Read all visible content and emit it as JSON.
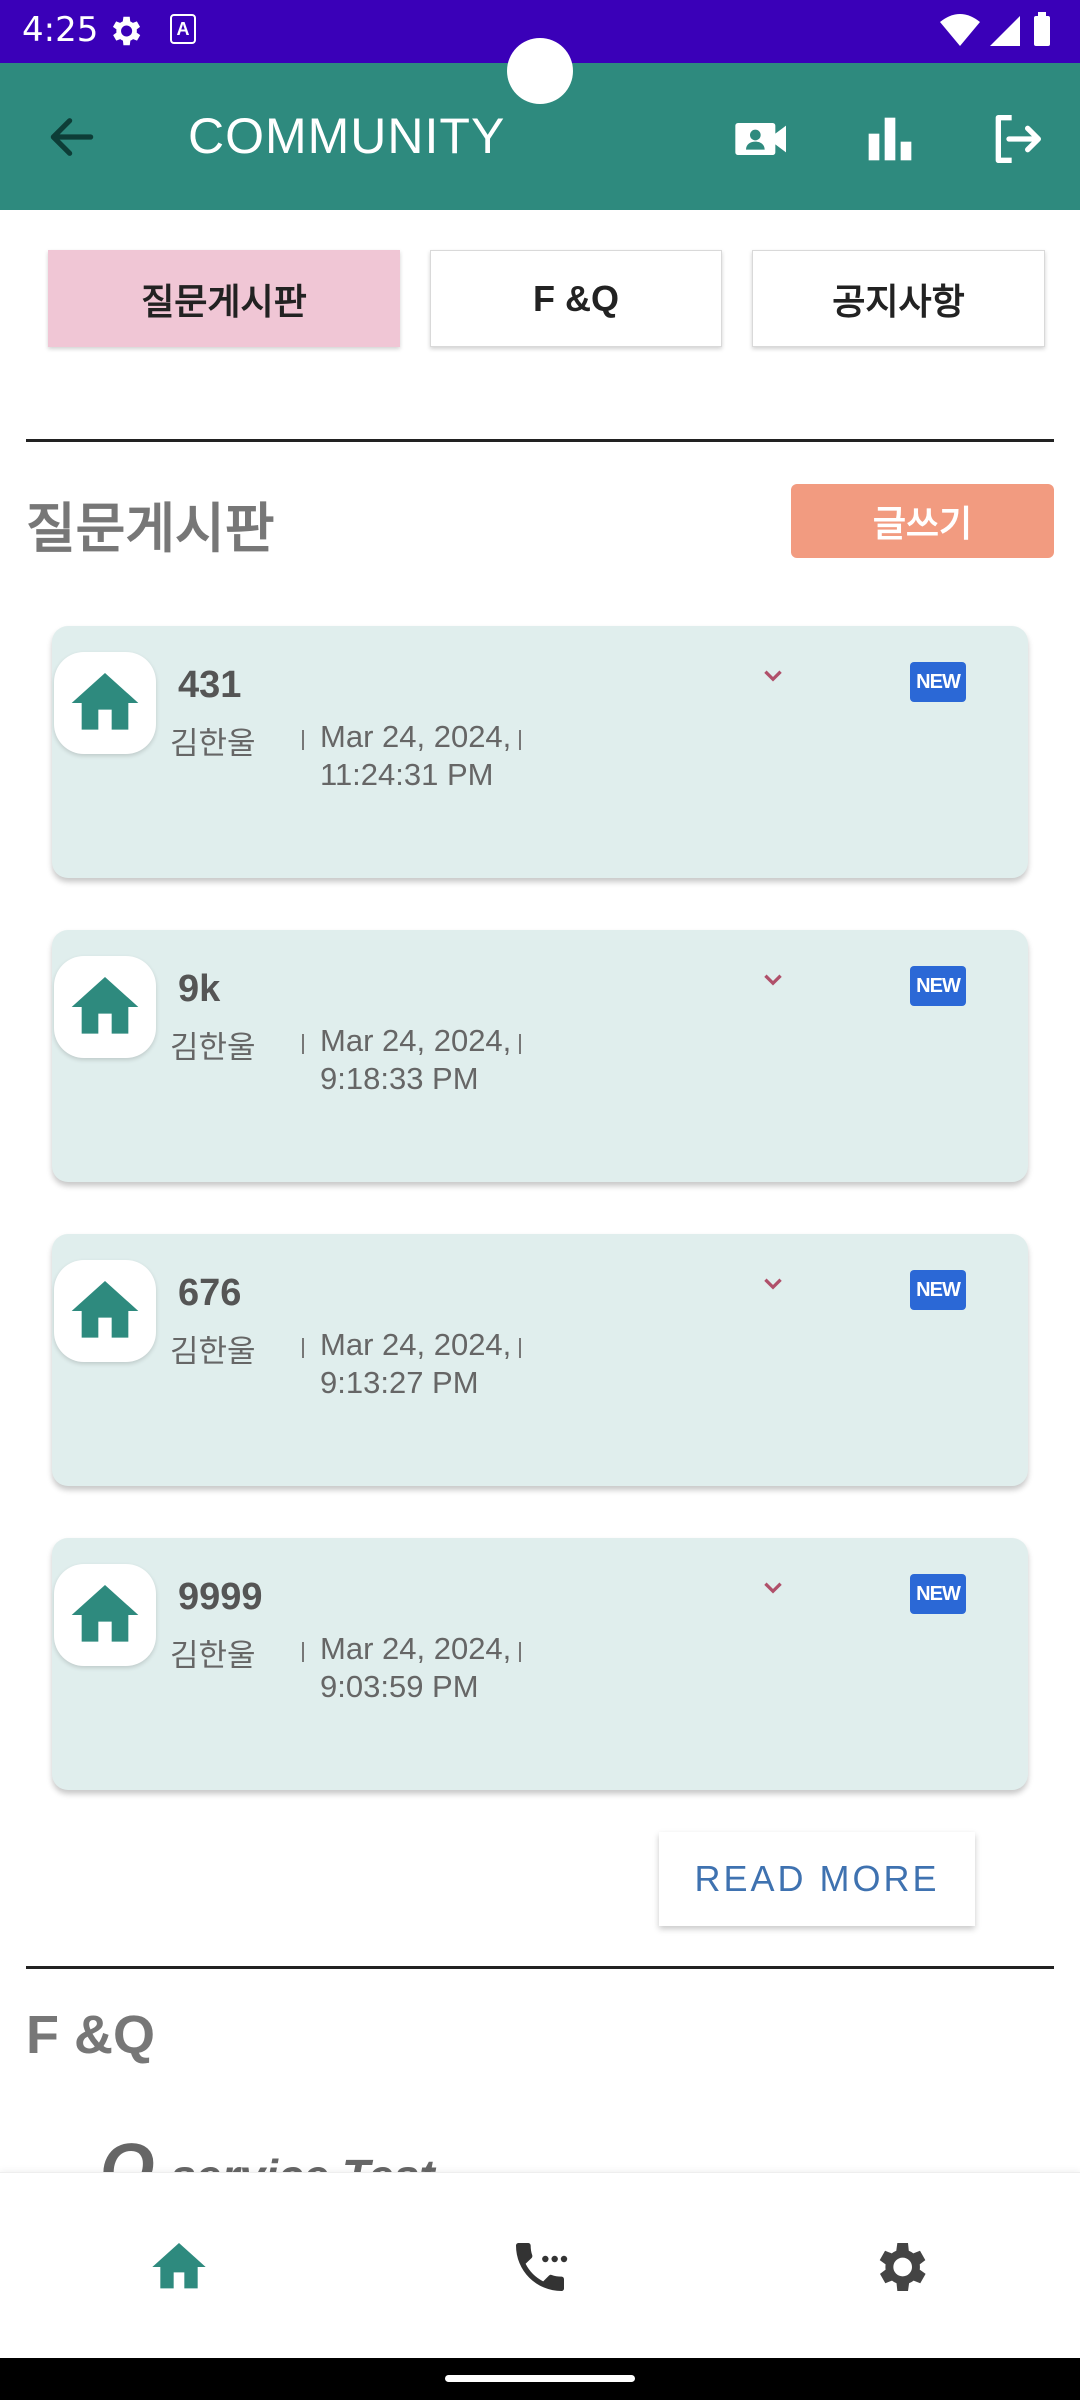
{
  "status_bar": {
    "time": "4:25"
  },
  "app_bar": {
    "title": "COMMUNITY"
  },
  "tabs": [
    {
      "label": "질문게시판",
      "active": true
    },
    {
      "label": "F &Q",
      "active": false
    },
    {
      "label": "공지사항",
      "active": false
    }
  ],
  "board": {
    "title": "질문게시판",
    "write_label": "글쓰기",
    "posts": [
      {
        "title": "431",
        "author": "김한울",
        "date": "Mar 24, 2024, 11:24:31 PM",
        "badge": "NEW"
      },
      {
        "title": "9k",
        "author": "김한울",
        "date": "Mar 24, 2024, 9:18:33 PM",
        "badge": "NEW"
      },
      {
        "title": "676",
        "author": "김한울",
        "date": "Mar 24, 2024, 9:13:27 PM",
        "badge": "NEW"
      },
      {
        "title": "9999",
        "author": "김한울",
        "date": "Mar 24, 2024, 9:03:59 PM",
        "badge": "NEW"
      }
    ],
    "read_more_label": "READ MORE"
  },
  "faq": {
    "title": "F &Q",
    "first_item": {
      "prefix": "Q",
      "text": "service Test"
    }
  },
  "colors": {
    "status_bar": "#3a00b8",
    "app_bar": "#2e8a7e",
    "tab_active": "#f0c6d5",
    "write_button": "#f29b80",
    "card_bg": "#e0eeed",
    "new_badge": "#2b68d6",
    "read_more_text": "#3f72b0"
  },
  "icons": {
    "app_bar": [
      "arrow-left-icon",
      "video-camera-icon",
      "bar-chart-icon",
      "logout-icon"
    ],
    "card": [
      "home-icon",
      "chevron-down-icon",
      "new-badge-icon"
    ],
    "bottom_nav": [
      "home-icon",
      "phone-icon",
      "gear-icon"
    ]
  }
}
